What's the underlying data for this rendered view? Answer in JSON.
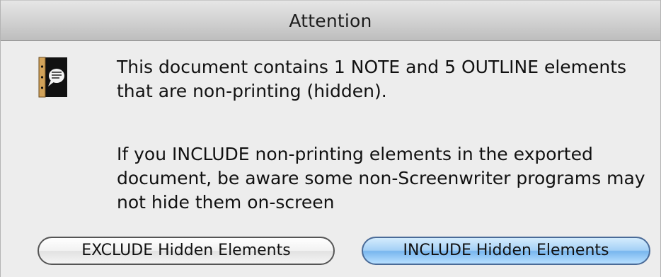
{
  "dialog": {
    "title": "Attention",
    "icon": "screenwriter-note-icon",
    "message_1": "This document contains 1 NOTE and 5 OUTLINE elements\nthat are non-printing (hidden).",
    "message_2": "If you INCLUDE non-printing elements in the exported\ndocument, be aware some non-Screenwriter programs may\nnot hide them on-screen"
  },
  "buttons": {
    "exclude_label": "EXCLUDE Hidden Elements",
    "include_label": "INCLUDE Hidden Elements"
  },
  "colors": {
    "default_button": "#8cc3f2",
    "window_background": "#ededed"
  }
}
